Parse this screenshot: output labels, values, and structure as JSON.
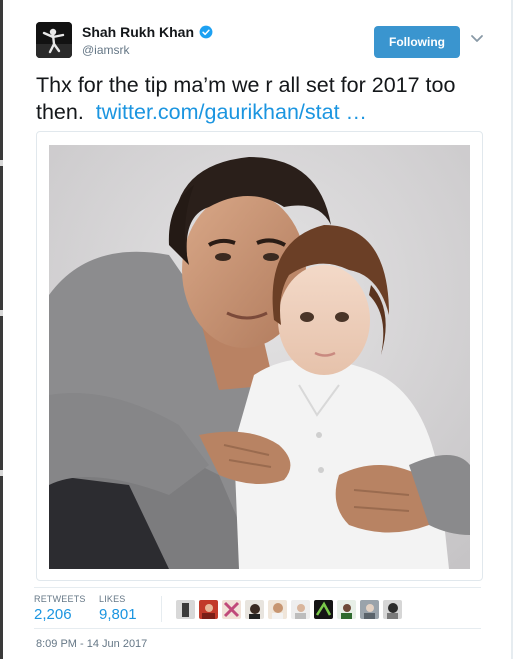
{
  "tweet": {
    "author": {
      "name": "Shah Rukh Khan",
      "handle": "@iamsrk",
      "verified": true
    },
    "follow_button_label": "Following",
    "text": "Thx for the tip ma’m we r all set for 2017 too then.",
    "link_text": "twitter.com/gaurikhan/stat …",
    "retweets_label": "RETWEETS",
    "retweets_count": "2,206",
    "likes_label": "LIKES",
    "likes_count": "9,801",
    "timestamp": "8:09 PM - 14 Jun 2017"
  },
  "icons": {
    "verified": "verified-badge-icon",
    "caret": "chevron-down-icon"
  },
  "colors": {
    "follow_button": "#3a95cf",
    "link": "#1b95e0",
    "muted": "#657786"
  }
}
